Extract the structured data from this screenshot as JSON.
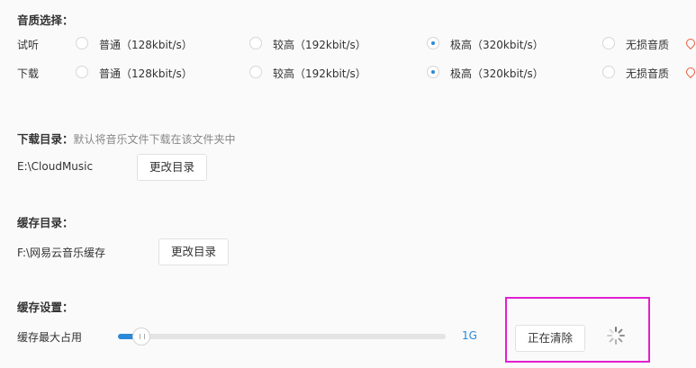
{
  "quality": {
    "heading": "音质选择：",
    "rows": [
      {
        "label": "试听",
        "options": [
          {
            "text": "普通（128kbit/s）",
            "selected": false
          },
          {
            "text": "较高（192kbit/s）",
            "selected": false
          },
          {
            "text": "极高（320kbit/s）",
            "selected": true
          },
          {
            "text": "无损音质",
            "selected": false
          }
        ]
      },
      {
        "label": "下载",
        "options": [
          {
            "text": "普通（128kbit/s）",
            "selected": false
          },
          {
            "text": "较高（192kbit/s）",
            "selected": false
          },
          {
            "text": "极高（320kbit/s）",
            "selected": true
          },
          {
            "text": "无损音质",
            "selected": false
          }
        ]
      }
    ]
  },
  "download_dir": {
    "heading": "下载目录：",
    "hint": "默认将音乐文件下载在该文件夹中",
    "path": "E:\\CloudMusic",
    "button": "更改目录"
  },
  "cache_dir": {
    "heading": "缓存目录：",
    "path": "F:\\网易云音乐缓存",
    "button": "更改目录"
  },
  "cache_settings": {
    "heading": "缓存设置：",
    "label": "缓存最大占用",
    "value": "1G",
    "fill_fraction": 0.08,
    "clear_button": "正在清除"
  },
  "colors": {
    "accent": "#2a8ad8",
    "highlight": "#e020d0",
    "lossless_icon": "#e95b3c"
  }
}
